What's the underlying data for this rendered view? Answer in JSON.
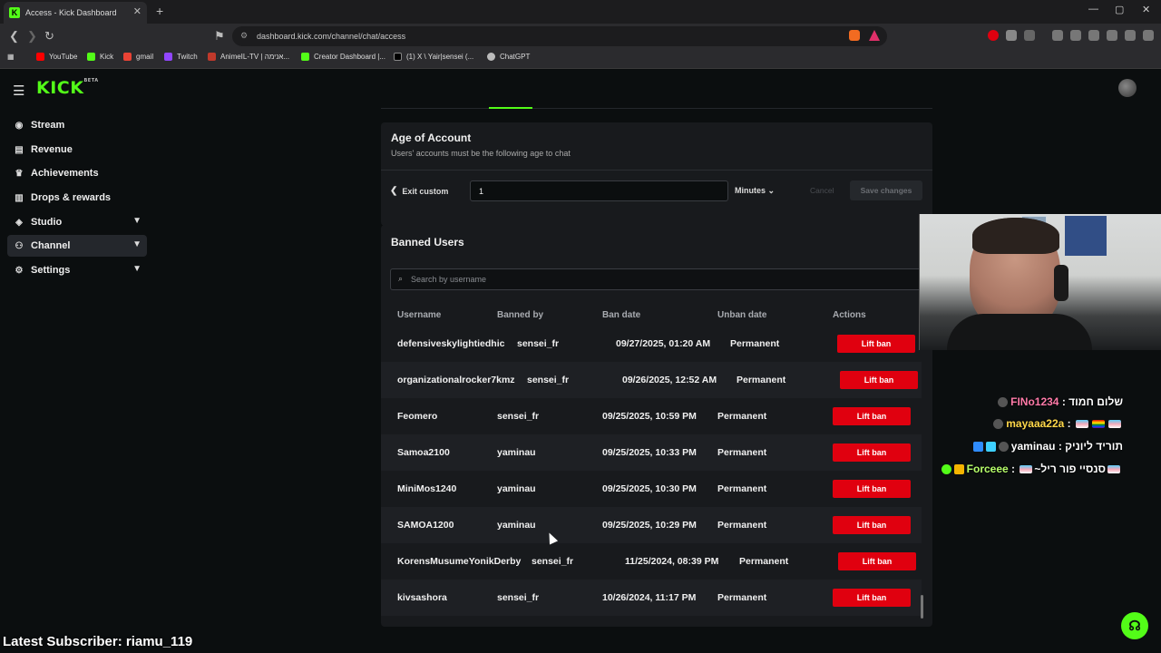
{
  "browser": {
    "tab_title": "Access - Kick Dashboard",
    "tab_favicon": "K",
    "close_tab": "✕",
    "new_tab": "+",
    "url": "dashboard.kick.com/channel/chat/access",
    "bookmarks": [
      "YouTube",
      "Kick",
      "gmail",
      "Twitch",
      "AnimeIL-TV | אנימה...",
      "Creator Dashboard |...",
      "(1) X \\ Yair|sensei (...",
      "ChatGPT"
    ]
  },
  "kick": {
    "logo": "KICK",
    "logo_sup": "BETA",
    "sidebar": [
      {
        "label": "Stream",
        "icon": "stream-icon",
        "glyph": "((•))"
      },
      {
        "label": "Revenue",
        "icon": "revenue-icon",
        "glyph": "▤"
      },
      {
        "label": "Achievements",
        "icon": "trophy-icon",
        "glyph": "🏆"
      },
      {
        "label": "Drops & rewards",
        "icon": "drops-icon",
        "glyph": "▥"
      },
      {
        "label": "Studio",
        "icon": "studio-icon",
        "glyph": "◈"
      },
      {
        "label": "Channel",
        "icon": "channel-icon",
        "glyph": "⚙"
      },
      {
        "label": "Settings",
        "icon": "settings-icon",
        "glyph": "⚙"
      }
    ],
    "age": {
      "title": "Age of Account",
      "subtitle": "Users' accounts must be the following age to chat",
      "exit_custom": "Exit custom",
      "value": "1",
      "unit": "Minutes",
      "cancel": "Cancel",
      "save": "Save changes"
    },
    "banned": {
      "title": "Banned Users",
      "search_placeholder": "Search by username",
      "headers": {
        "username": "Username",
        "banned_by": "Banned by",
        "ban_date": "Ban date",
        "unban_date": "Unban date",
        "actions": "Actions"
      },
      "action_label": "Lift ban",
      "rows": [
        {
          "username": "defensiveskylightiedhic",
          "banned_by": "sensei_fr",
          "ban_date": "09/27/2025, 01:20 AM",
          "unban_date": "Permanent"
        },
        {
          "username": "organizationalrocker7kmz",
          "banned_by": "sensei_fr",
          "ban_date": "09/26/2025, 12:52 AM",
          "unban_date": "Permanent"
        },
        {
          "username": "Feomero",
          "banned_by": "sensei_fr",
          "ban_date": "09/25/2025, 10:59 PM",
          "unban_date": "Permanent"
        },
        {
          "username": "Samoa2100",
          "banned_by": "yaminau",
          "ban_date": "09/25/2025, 10:33 PM",
          "unban_date": "Permanent"
        },
        {
          "username": "MiniMos1240",
          "banned_by": "yaminau",
          "ban_date": "09/25/2025, 10:30 PM",
          "unban_date": "Permanent"
        },
        {
          "username": "SAMOA1200",
          "banned_by": "yaminau",
          "ban_date": "09/25/2025, 10:29 PM",
          "unban_date": "Permanent"
        },
        {
          "username": "KorensMusumeYonikDerby",
          "banned_by": "sensei_fr",
          "ban_date": "11/25/2024, 08:39 PM",
          "unban_date": "Permanent"
        },
        {
          "username": "kivsashora",
          "banned_by": "sensei_fr",
          "ban_date": "10/26/2024, 11:17 PM",
          "unban_date": "Permanent"
        }
      ]
    }
  },
  "overlay": {
    "chat": [
      {
        "user": "FINo1234",
        "user_color": "#ff7aa8",
        "message": "שלום חמוד"
      },
      {
        "user": "mayaaa22a",
        "user_color": "#ffd84a",
        "message": ""
      },
      {
        "user": "yaminau",
        "user_color": "#ffffff",
        "message": "תוריד ליוניק"
      },
      {
        "user": "Forceee",
        "user_color": "#b7ff6a",
        "message": "~סנסיי פור ריל"
      }
    ],
    "latest_subscriber": "Latest Subscriber: riamu_119"
  },
  "colors": {
    "accent": "#53fc18",
    "danger": "#e0000f",
    "bg": "#0b0e0f",
    "card": "#181a1d"
  }
}
